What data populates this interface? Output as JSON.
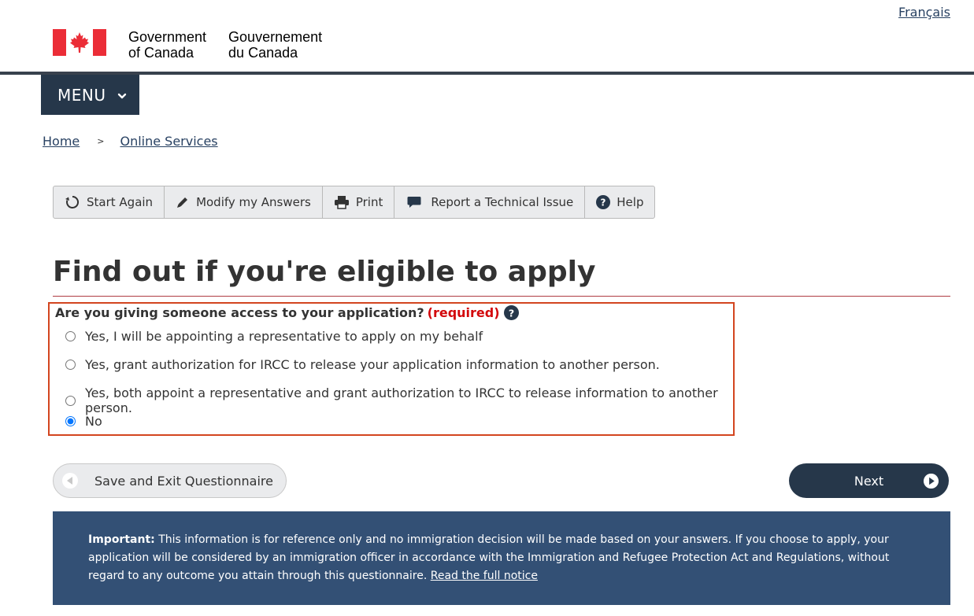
{
  "header": {
    "language_link": "Français",
    "gov_en_line1": "Government",
    "gov_en_line2": "of Canada",
    "gov_fr_line1": "Gouvernement",
    "gov_fr_line2": "du Canada",
    "menu_label": "MENU"
  },
  "breadcrumb": {
    "items": [
      "Home",
      "Online Services"
    ],
    "separator": ">"
  },
  "toolbar": {
    "items": [
      {
        "label": "Start Again",
        "icon": "refresh-icon"
      },
      {
        "label": "Modify my Answers",
        "icon": "pencil-icon"
      },
      {
        "label": "Print",
        "icon": "printer-icon"
      },
      {
        "label": "Report a Technical Issue",
        "icon": "speech-bubble-icon"
      },
      {
        "label": "Help",
        "icon": "question-circle-icon"
      }
    ]
  },
  "page": {
    "title": "Find out if you're eligible to apply"
  },
  "question": {
    "label": "Are you giving someone access to your application?",
    "required_text": "(required)",
    "options": [
      {
        "label": "Yes, I will be appointing a representative to apply on my behalf",
        "checked": false
      },
      {
        "label": "Yes, grant authorization for IRCC to release your application information to another person.",
        "checked": false
      },
      {
        "label": "Yes, both appoint a representative and grant authorization to IRCC to release information to another person.",
        "checked": false
      },
      {
        "label": "No",
        "checked": true
      }
    ]
  },
  "actions": {
    "save_exit_label": "Save and Exit Questionnaire",
    "next_label": "Next"
  },
  "notice": {
    "important_label": "Important:",
    "text": "This information is for reference only and no immigration decision will be made based on your answers. If you choose to apply, your application will be considered by an immigration officer in accordance with the Immigration and Refugee Protection Act and Regulations, without regard to any outcome you attain through this questionnaire.",
    "link_text": "Read the full notice"
  },
  "colors": {
    "flag_red": "#eb2d37",
    "menu_bg": "#26374a",
    "error_border": "#d3451f",
    "required_red": "#d3080c",
    "notice_bg": "#335075",
    "link": "#284162"
  }
}
